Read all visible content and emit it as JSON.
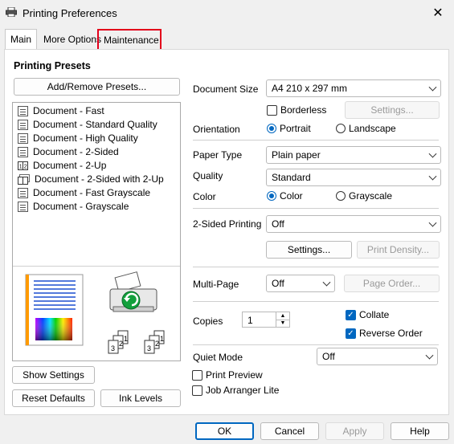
{
  "window": {
    "title": "Printing Preferences"
  },
  "tabs": [
    {
      "label": "Main"
    },
    {
      "label": "More Options"
    },
    {
      "label": "Maintenance"
    }
  ],
  "presets": {
    "title": "Printing Presets",
    "add_remove_label": "Add/Remove Presets...",
    "items": [
      {
        "label": "Document - Fast",
        "icon": "document-icon"
      },
      {
        "label": "Document - Standard Quality",
        "icon": "document-icon"
      },
      {
        "label": "Document - High Quality",
        "icon": "document-icon"
      },
      {
        "label": "Document - 2-Sided",
        "icon": "two-sided-icon"
      },
      {
        "label": "Document - 2-Up",
        "icon": "two-up-icon"
      },
      {
        "label": "Document - 2-Sided with 2-Up",
        "icon": "two-sided-two-up-icon"
      },
      {
        "label": "Document - Fast Grayscale",
        "icon": "document-icon"
      },
      {
        "label": "Document - Grayscale",
        "icon": "document-icon"
      }
    ]
  },
  "settings": {
    "document_size": {
      "label": "Document Size",
      "value": "A4 210 x 297 mm"
    },
    "borderless": {
      "label": "Borderless",
      "checked": false
    },
    "settings_btn1": "Settings...",
    "orientation": {
      "label": "Orientation",
      "portrait": "Portrait",
      "landscape": "Landscape",
      "selected": "Portrait"
    },
    "paper_type": {
      "label": "Paper Type",
      "value": "Plain paper"
    },
    "quality": {
      "label": "Quality",
      "value": "Standard"
    },
    "color": {
      "label": "Color",
      "color": "Color",
      "grayscale": "Grayscale",
      "selected": "Color"
    },
    "two_sided": {
      "label": "2-Sided Printing",
      "value": "Off"
    },
    "settings_btn2": "Settings...",
    "print_density": "Print Density...",
    "multi_page": {
      "label": "Multi-Page",
      "value": "Off"
    },
    "page_order": "Page Order...",
    "copies": {
      "label": "Copies",
      "value": "1"
    },
    "collate": {
      "label": "Collate",
      "checked": true
    },
    "reverse_order": {
      "label": "Reverse Order",
      "checked": true
    },
    "quiet_mode": {
      "label": "Quiet Mode",
      "value": "Off"
    },
    "print_preview": {
      "label": "Print Preview",
      "checked": false
    },
    "job_arranger": {
      "label": "Job Arranger Lite",
      "checked": false
    }
  },
  "left_buttons": {
    "show_settings": "Show Settings",
    "reset_defaults": "Reset Defaults",
    "ink_levels": "Ink Levels"
  },
  "footer": {
    "ok": "OK",
    "cancel": "Cancel",
    "apply": "Apply",
    "help": "Help"
  },
  "colors": {
    "accent": "#0067c0",
    "highlight": "#e3001b"
  }
}
